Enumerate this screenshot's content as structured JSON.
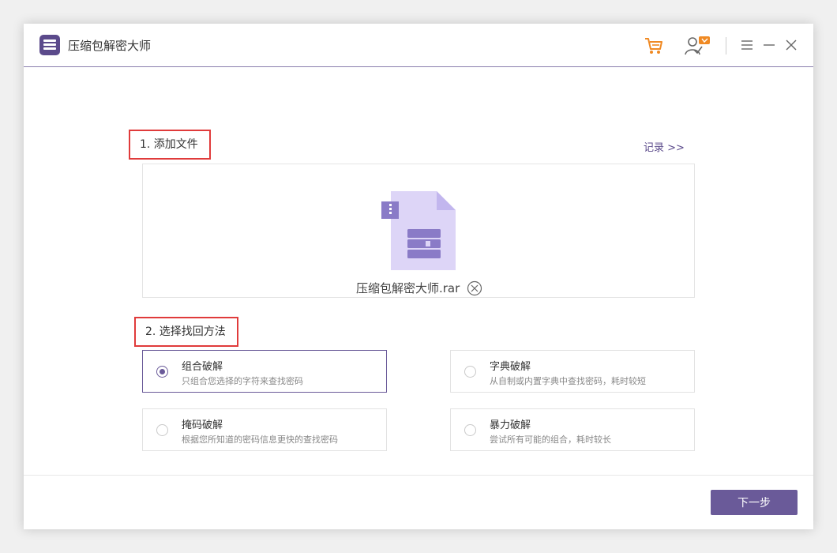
{
  "app": {
    "title": "压缩包解密大师"
  },
  "step1": {
    "label": "1. 添加文件",
    "record_link": "记录 >>"
  },
  "file": {
    "name": "压缩包解密大师.rar"
  },
  "step2": {
    "label": "2. 选择找回方法"
  },
  "methods": [
    {
      "title": "组合破解",
      "desc": "只组合您选择的字符来查找密码",
      "selected": true
    },
    {
      "title": "字典破解",
      "desc": "从自制或内置字典中查找密码，耗时较短",
      "selected": false
    },
    {
      "title": "掩码破解",
      "desc": "根据您所知道的密码信息更快的查找密码",
      "selected": false
    },
    {
      "title": "暴力破解",
      "desc": "尝试所有可能的组合，耗时较长",
      "selected": false
    }
  ],
  "footer": {
    "next_label": "下一步"
  },
  "colors": {
    "accent": "#6a5a99",
    "highlight_box": "#e03b3b",
    "cart": "#f08a24"
  }
}
